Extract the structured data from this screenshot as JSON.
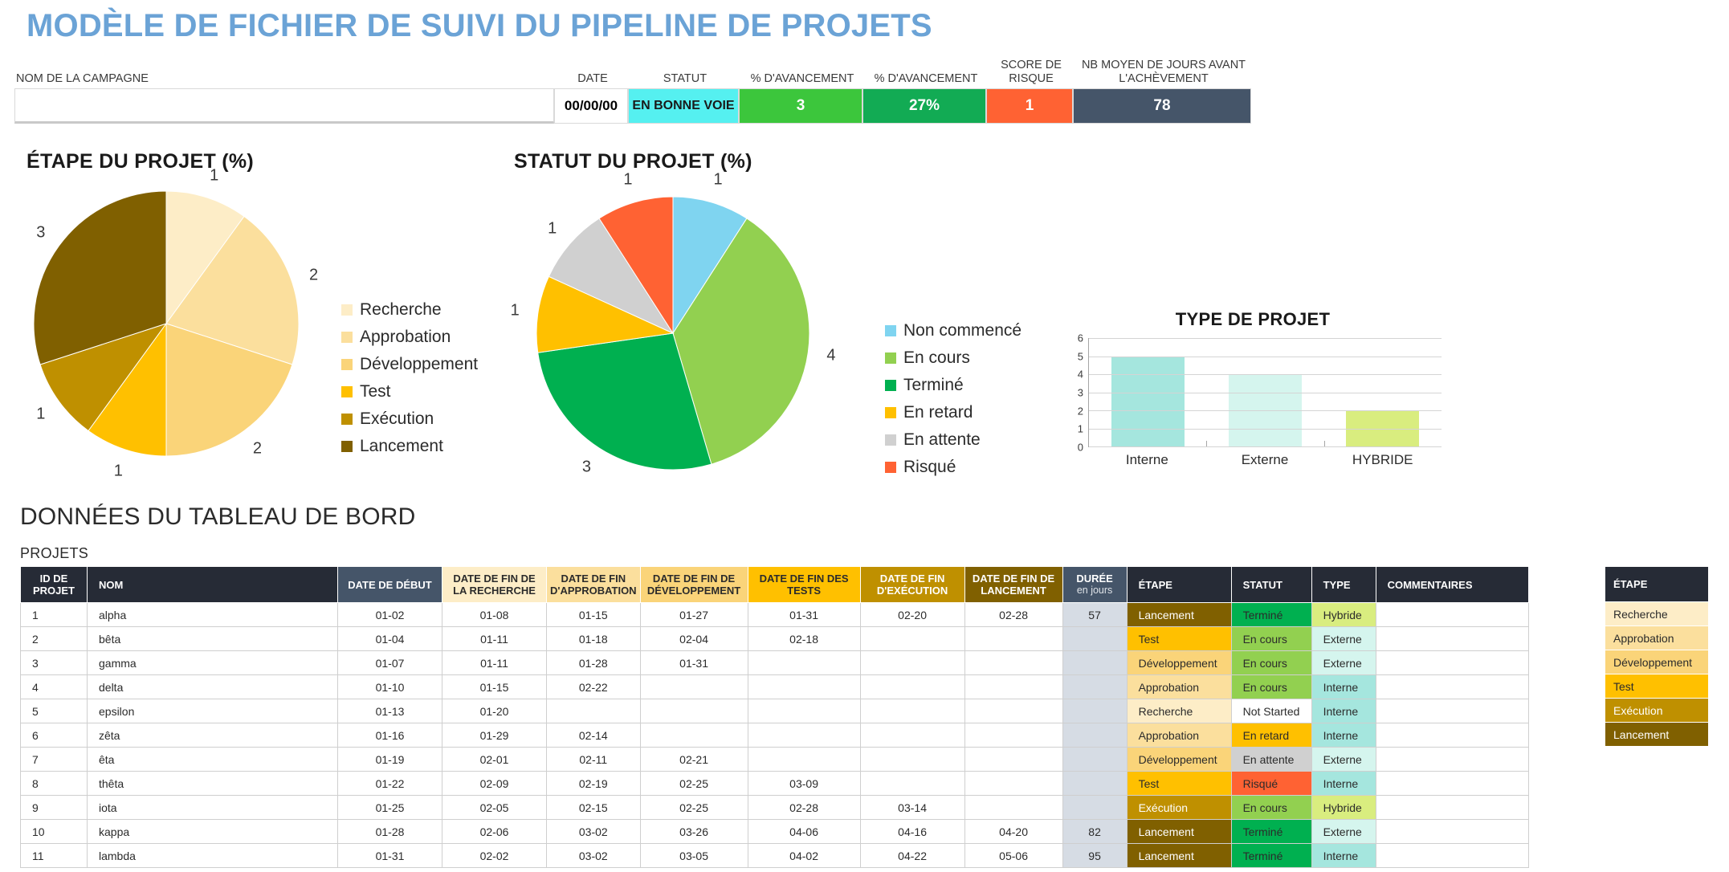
{
  "title": "MODÈLE DE FICHIER DE SUIVI DU PIPELINE DE PROJETS",
  "summary": {
    "headers": {
      "campaign": "NOM DE LA CAMPAGNE",
      "date": "DATE",
      "status": "STATUT",
      "advancement1": "% D'AVANCEMENT",
      "advancement2": "% D'AVANCEMENT",
      "risk": "SCORE DE RISQUE",
      "days": "NB MOYEN DE JOURS AVANT L'ACHÈVEMENT"
    },
    "values": {
      "campaign": "",
      "date": "00/00/00",
      "status": "EN BONNE VOIE",
      "advancement1": "3",
      "advancement2": "27%",
      "risk": "1",
      "days": "78"
    },
    "colors": {
      "status_bg": "#55f0f0",
      "advancement1_bg": "#3cc63c",
      "advancement2_bg": "#12ab54",
      "risk_bg": "#ff6233",
      "days_bg": "#455569"
    }
  },
  "chart_data": [
    {
      "type": "pie",
      "title": "ÉTAPE DU PROJET (%)",
      "categories": [
        "Recherche",
        "Approbation",
        "Développement",
        "Test",
        "Exécution",
        "Lancement"
      ],
      "values": [
        1,
        2,
        2,
        1,
        1,
        3
      ],
      "labels": [
        "1",
        "2",
        "2",
        "1",
        "1",
        "3"
      ],
      "colors": [
        "#fdedc7",
        "#fbdf9d",
        "#fad479",
        "#ffc000",
        "#bf9000",
        "#806000"
      ],
      "legend_position": "right"
    },
    {
      "type": "pie",
      "title": "STATUT DU PROJET (%)",
      "categories": [
        "Non commencé",
        "En cours",
        "Terminé",
        "En retard",
        "En attente",
        "Risqué"
      ],
      "values": [
        1,
        4,
        3,
        1,
        1,
        1
      ],
      "labels": [
        "1",
        "4",
        "3",
        "1",
        "1",
        "1"
      ],
      "colors": [
        "#7fd4f0",
        "#92d050",
        "#00b050",
        "#ffc000",
        "#d0d0d0",
        "#ff6233"
      ],
      "legend_position": "right"
    },
    {
      "type": "bar",
      "title": "TYPE DE PROJET",
      "categories": [
        "Interne",
        "Externe",
        "HYBRIDE"
      ],
      "values": [
        5,
        4,
        2
      ],
      "colors": [
        "#a5e6de",
        "#d5f5ee",
        "#d9ed7f"
      ],
      "ylim": [
        0,
        6
      ],
      "yticks": [
        "6",
        "5",
        "4",
        "3",
        "2",
        "1",
        "0"
      ],
      "xlabel": "",
      "ylabel": "",
      "grid": true
    }
  ],
  "dashboard": {
    "section_title": "DONNÉES DU TABLEAU DE BORD",
    "projects_label": "PROJETS",
    "columns": [
      {
        "label": "ID DE PROJET",
        "bg": "#262b36",
        "fg": "#ffffff"
      },
      {
        "label": "NOM",
        "bg": "#262b36",
        "fg": "#ffffff"
      },
      {
        "label": "DATE DE DÉBUT",
        "bg": "#455569",
        "fg": "#ffffff"
      },
      {
        "label": "DATE DE FIN DE LA RECHERCHE",
        "bg": "#fdedc7",
        "fg": "#2b2b2b"
      },
      {
        "label": "DATE DE FIN D'APPROBATION",
        "bg": "#fbdf9d",
        "fg": "#2b2b2b"
      },
      {
        "label": "DATE DE FIN DE DÉVELOPPEMENT",
        "bg": "#fad479",
        "fg": "#2b2b2b"
      },
      {
        "label": "DATE DE FIN DES TESTS",
        "bg": "#ffc000",
        "fg": "#2b2b2b"
      },
      {
        "label": "DATE DE FIN D'EXÉCUTION",
        "bg": "#bf9000",
        "fg": "#ffffff"
      },
      {
        "label": "DATE DE FIN  DE LANCEMENT",
        "bg": "#806000",
        "fg": "#ffffff"
      },
      {
        "label": "DURÉE",
        "sub": "en jours",
        "bg": "#455569",
        "fg": "#ffffff"
      },
      {
        "label": "ÉTAPE",
        "bg": "#262b36",
        "fg": "#ffffff"
      },
      {
        "label": "STATUT",
        "bg": "#262b36",
        "fg": "#ffffff"
      },
      {
        "label": "TYPE",
        "bg": "#262b36",
        "fg": "#ffffff"
      },
      {
        "label": "COMMENTAIRES",
        "bg": "#262b36",
        "fg": "#ffffff"
      }
    ],
    "rows": [
      {
        "id": "1",
        "nom": "alpha",
        "debut": "01-02",
        "recherche": "01-08",
        "approbation": "01-15",
        "developpement": "01-27",
        "tests": "01-31",
        "execution": "02-20",
        "lancement": "02-28",
        "duree": "57",
        "etape": "Lancement",
        "statut": "Terminé",
        "type": "Hybride",
        "commentaires": ""
      },
      {
        "id": "2",
        "nom": "bêta",
        "debut": "01-04",
        "recherche": "01-11",
        "approbation": "01-18",
        "developpement": "02-04",
        "tests": "02-18",
        "execution": "",
        "lancement": "",
        "duree": "",
        "etape": "Test",
        "statut": "En cours",
        "type": "Externe",
        "commentaires": ""
      },
      {
        "id": "3",
        "nom": "gamma",
        "debut": "01-07",
        "recherche": "01-11",
        "approbation": "01-28",
        "developpement": "01-31",
        "tests": "",
        "execution": "",
        "lancement": "",
        "duree": "",
        "etape": "Développement",
        "statut": "En cours",
        "type": "Externe",
        "commentaires": ""
      },
      {
        "id": "4",
        "nom": "delta",
        "debut": "01-10",
        "recherche": "01-15",
        "approbation": "02-22",
        "developpement": "",
        "tests": "",
        "execution": "",
        "lancement": "",
        "duree": "",
        "etape": "Approbation",
        "statut": "En cours",
        "type": "Interne",
        "commentaires": ""
      },
      {
        "id": "5",
        "nom": "epsilon",
        "debut": "01-13",
        "recherche": "01-20",
        "approbation": "",
        "developpement": "",
        "tests": "",
        "execution": "",
        "lancement": "",
        "duree": "",
        "etape": "Recherche",
        "statut": "Not Started",
        "type": "Interne",
        "commentaires": ""
      },
      {
        "id": "6",
        "nom": "zêta",
        "debut": "01-16",
        "recherche": "01-29",
        "approbation": "02-14",
        "developpement": "",
        "tests": "",
        "execution": "",
        "lancement": "",
        "duree": "",
        "etape": "Approbation",
        "statut": "En retard",
        "type": "Interne",
        "commentaires": ""
      },
      {
        "id": "7",
        "nom": "êta",
        "debut": "01-19",
        "recherche": "02-01",
        "approbation": "02-11",
        "developpement": "02-21",
        "tests": "",
        "execution": "",
        "lancement": "",
        "duree": "",
        "etape": "Développement",
        "statut": "En attente",
        "type": "Externe",
        "commentaires": ""
      },
      {
        "id": "8",
        "nom": "thêta",
        "debut": "01-22",
        "recherche": "02-09",
        "approbation": "02-19",
        "developpement": "02-25",
        "tests": "03-09",
        "execution": "",
        "lancement": "",
        "duree": "",
        "etape": "Test",
        "statut": "Risqué",
        "type": "Interne",
        "commentaires": ""
      },
      {
        "id": "9",
        "nom": "iota",
        "debut": "01-25",
        "recherche": "02-05",
        "approbation": "02-15",
        "developpement": "02-25",
        "tests": "02-28",
        "execution": "03-14",
        "lancement": "",
        "duree": "",
        "etape": "Exécution",
        "statut": "En cours",
        "type": "Hybride",
        "commentaires": ""
      },
      {
        "id": "10",
        "nom": "kappa",
        "debut": "01-28",
        "recherche": "02-06",
        "approbation": "03-02",
        "developpement": "03-26",
        "tests": "04-06",
        "execution": "04-16",
        "lancement": "04-20",
        "duree": "82",
        "etape": "Lancement",
        "statut": "Terminé",
        "type": "Externe",
        "commentaires": ""
      },
      {
        "id": "11",
        "nom": "lambda",
        "debut": "01-31",
        "recherche": "02-02",
        "approbation": "03-02",
        "developpement": "03-05",
        "tests": "04-02",
        "execution": "04-22",
        "lancement": "05-06",
        "duree": "95",
        "etape": "Lancement",
        "statut": "Terminé",
        "type": "Interne",
        "commentaires": ""
      }
    ],
    "etape_colors": {
      "Recherche": {
        "bg": "#fdedc7",
        "fg": "#2b2b2b"
      },
      "Approbation": {
        "bg": "#fbdf9d",
        "fg": "#2b2b2b"
      },
      "Développement": {
        "bg": "#fad479",
        "fg": "#2b2b2b"
      },
      "Test": {
        "bg": "#ffc000",
        "fg": "#2b2b2b"
      },
      "Exécution": {
        "bg": "#bf9000",
        "fg": "#ffffff"
      },
      "Lancement": {
        "bg": "#806000",
        "fg": "#ffffff"
      }
    },
    "statut_colors": {
      "Not Started": {
        "bg": "#ffffff",
        "fg": "#2b2b2b"
      },
      "En cours": {
        "bg": "#92d050",
        "fg": "#2b2b2b"
      },
      "Terminé": {
        "bg": "#00b050",
        "fg": "#2b2b2b"
      },
      "En retard": {
        "bg": "#ffc000",
        "fg": "#2b2b2b"
      },
      "En attente": {
        "bg": "#d0d0d0",
        "fg": "#2b2b2b"
      },
      "Risqué": {
        "bg": "#ff6233",
        "fg": "#2b2b2b"
      }
    },
    "type_colors": {
      "Interne": {
        "bg": "#a5e6de",
        "fg": "#2b2b2b"
      },
      "Externe": {
        "bg": "#d5f5ee",
        "fg": "#2b2b2b"
      },
      "Hybride": {
        "bg": "#d9ed7f",
        "fg": "#2b2b2b"
      }
    },
    "duree_bg": "#d6dce4"
  },
  "stage_legend": {
    "header": "ÉTAPE",
    "items": [
      {
        "label": "Recherche",
        "bg": "#fdedc7",
        "fg": "#2b2b2b"
      },
      {
        "label": "Approbation",
        "bg": "#fbdf9d",
        "fg": "#2b2b2b"
      },
      {
        "label": "Développement",
        "bg": "#fad479",
        "fg": "#2b2b2b"
      },
      {
        "label": "Test",
        "bg": "#ffc000",
        "fg": "#2b2b2b"
      },
      {
        "label": "Exécution",
        "bg": "#bf9000",
        "fg": "#ffffff"
      },
      {
        "label": "Lancement",
        "bg": "#806000",
        "fg": "#ffffff"
      }
    ]
  }
}
